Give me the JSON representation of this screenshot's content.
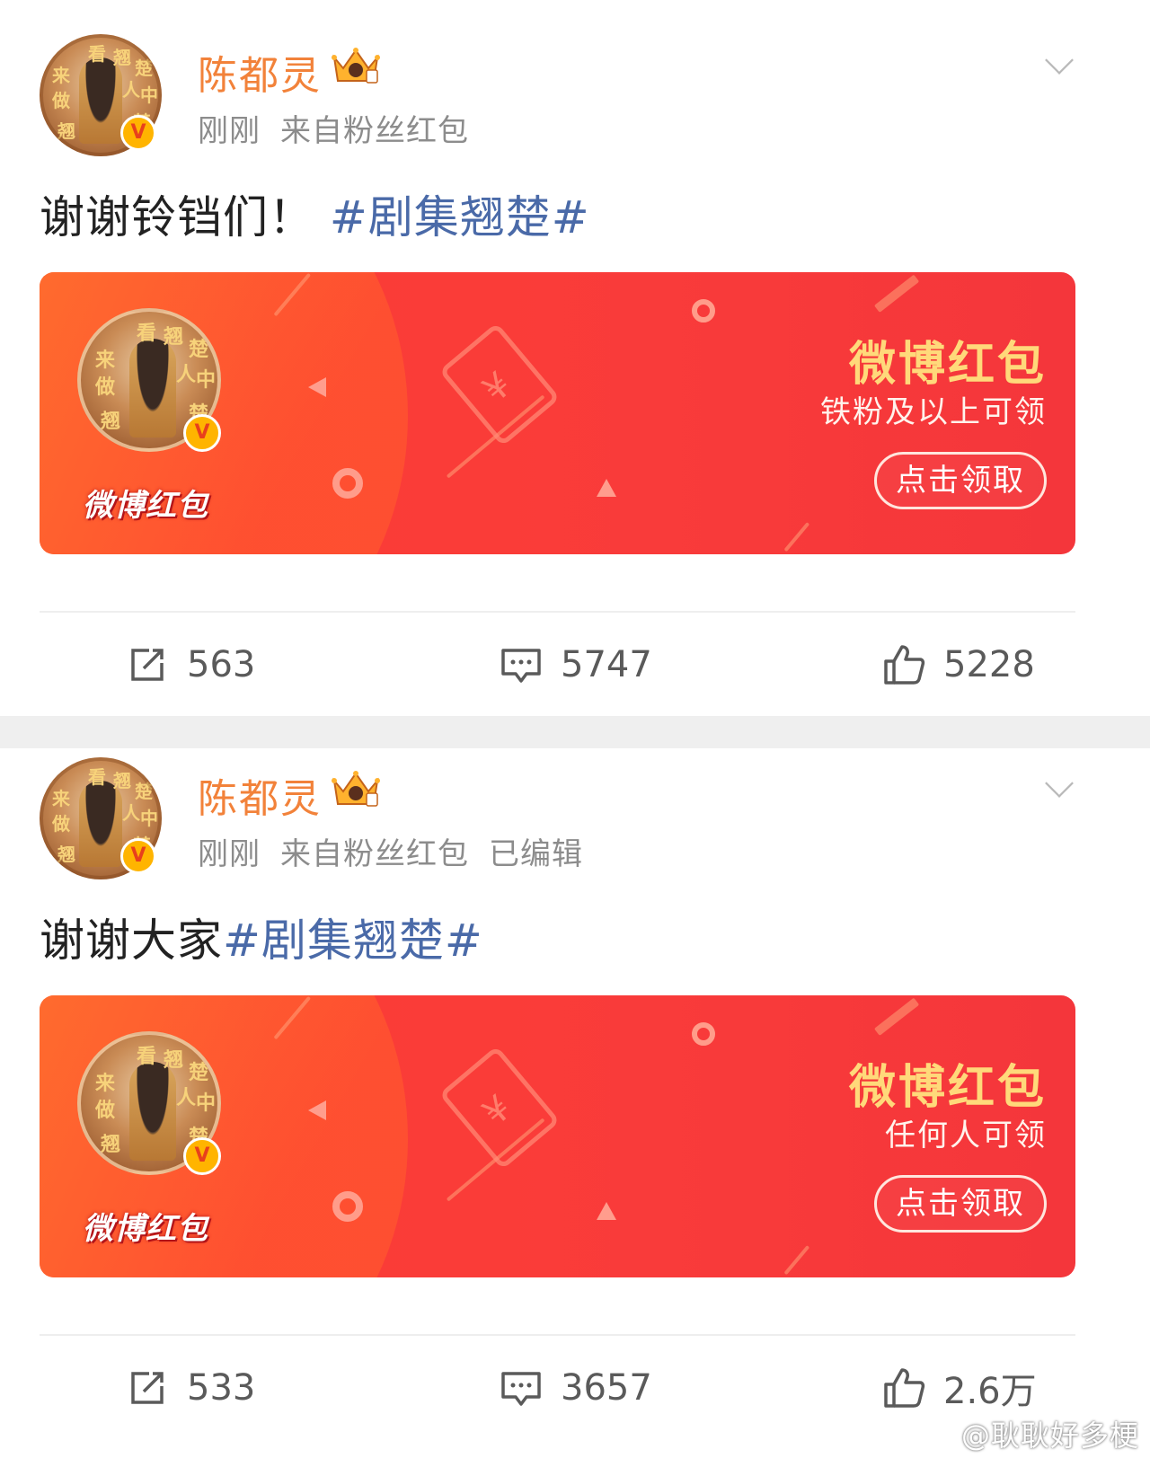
{
  "posts": [
    {
      "username": "陈都灵",
      "time": "刚刚",
      "source": "来自粉丝红包",
      "edited": "",
      "text": "谢谢铃铛们！",
      "hashtag": "#剧集翘楚#",
      "card": {
        "title": "微博红包",
        "subtitle": "铁粉及以上可领",
        "button": "点击领取",
        "brand": "微博红包"
      },
      "reposts": "563",
      "comments": "5747",
      "likes": "5228"
    },
    {
      "username": "陈都灵",
      "time": "刚刚",
      "source": "来自粉丝红包",
      "edited": "已编辑",
      "text": "谢谢大家",
      "hashtag": "#剧集翘楚#",
      "card": {
        "title": "微博红包",
        "subtitle": "任何人可领",
        "button": "点击领取",
        "brand": "微博红包"
      },
      "reposts": "533",
      "comments": "3657",
      "likes": "2.6万"
    }
  ],
  "avatar_text": [
    "来",
    "看",
    "翘",
    "楚",
    "做",
    "人",
    "中",
    "翘",
    "楚"
  ],
  "verified_mark": "V",
  "watermark": "@耿耿好多梗",
  "icons": {
    "repost": "repost-icon",
    "comment": "comment-icon",
    "like": "thumbs-up-icon",
    "crown": "crown-badge-icon",
    "more": "chevron-down-icon"
  },
  "colors": {
    "username": "#f2823a",
    "hashtag": "#4a6aa8",
    "card_red": "#f93b3a",
    "card_title": "#ffd97a",
    "verified": "#ffb400"
  }
}
